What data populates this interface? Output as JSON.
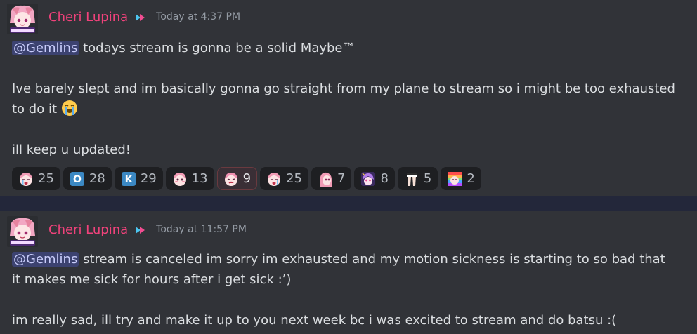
{
  "colors": {
    "background": "#313338",
    "username": "#f0427b",
    "mention_bg": "#3c4270",
    "mention_text": "#c9cdfb",
    "timestamp": "#949ba4",
    "reaction_bg": "#1e1f22"
  },
  "messages": [
    {
      "author": "Cheri Lupina",
      "timestamp": "Today at 4:37 PM",
      "mention": "@Gemlins",
      "lines": [
        "todays stream is gonna be a solid Maybe™",
        "Ive barely slept and im basically gonna go straight from my plane to stream so i might be too exhausted",
        "to do it",
        "ill keep u updated!"
      ],
      "reactions": [
        {
          "icon": "cheri-crying-emote-icon",
          "count": "25"
        },
        {
          "icon": "letter-o-icon",
          "count": "28",
          "letter": "O"
        },
        {
          "icon": "letter-k-icon",
          "count": "29",
          "letter": "K"
        },
        {
          "icon": "cheri-blush-emote-icon",
          "count": "13"
        },
        {
          "icon": "cheri-sad-emote-icon",
          "count": "9"
        },
        {
          "icon": "cheri-crying-emote-icon",
          "count": "25"
        },
        {
          "icon": "cheri-peek-emote-icon",
          "count": "7"
        },
        {
          "icon": "purple-character-emote-icon",
          "count": "8"
        },
        {
          "icon": "legs-emote-icon",
          "count": "5"
        },
        {
          "icon": "rainbow-cheri-emote-icon",
          "count": "2"
        }
      ]
    },
    {
      "author": "Cheri Lupina",
      "timestamp": "Today at 11:57 PM",
      "mention": "@Gemlins",
      "lines": [
        "stream is canceled im sorry im exhausted and my motion sickness is starting to so bad that",
        "it makes me sick for hours after i get sick :’)",
        "im really sad, ill try and make it up to you next week bc i was excited to stream and do batsu :("
      ]
    }
  ]
}
